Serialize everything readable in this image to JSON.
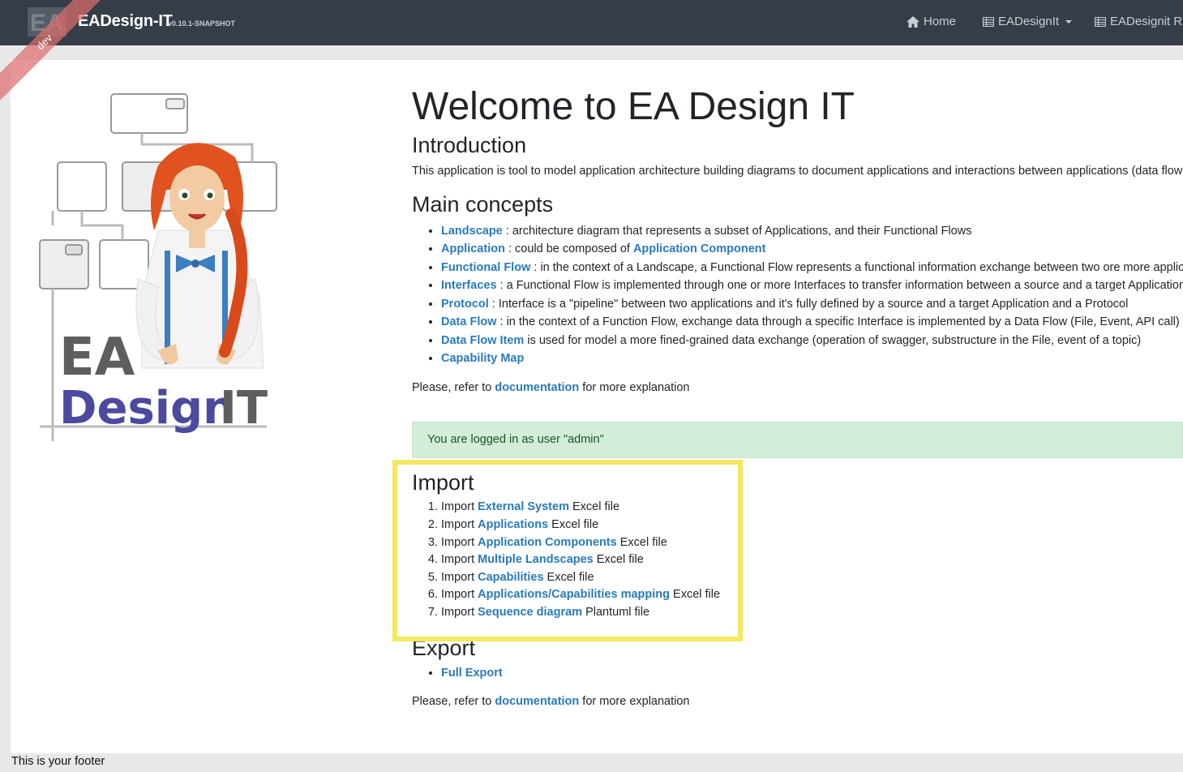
{
  "navbar": {
    "brand_title": "EADesign-IT",
    "brand_version": "v0.10.1-SNAPSHOT",
    "ribbon_label": "dev",
    "home_label": "Home",
    "eadesignit_label": "EADesignIt",
    "eadesignit_r_label": "EADesignit Re"
  },
  "illustration": {
    "line1": "EA",
    "line2a": "Design",
    "line2b": "IT"
  },
  "main": {
    "title": "Welcome to EA Design IT",
    "intro_heading": "Introduction",
    "intro_text": "This application is tool to model application architecture building diagrams to document applications and interactions between applications (data flows)",
    "concepts_heading": "Main concepts",
    "concepts": [
      {
        "link": "Landscape",
        "text": " : architecture diagram that represents a subset of Applications, and their Functional Flows"
      },
      {
        "link": "Application",
        "text": " : could be composed of ",
        "link2": "Application Component"
      },
      {
        "link": "Functional Flow",
        "text": " : in the context of a Landscape, a Functional Flow represents a functional information exchange between two ore more applica"
      },
      {
        "link": "Interfaces",
        "text": " : a Functional Flow is implemented through one or more Interfaces to transfer information between a source and a target Application."
      },
      {
        "link": "Protocol",
        "text": " : Interface is a \"pipeline\" between two applications and it's fully defined by a source and a target Application and a Protocol"
      },
      {
        "link": "Data Flow",
        "text": " : in the context of a Function Flow, exchange data through a specific Interface is implemented by a Data Flow (File, Event, API call)"
      },
      {
        "link": "Data Flow Item",
        "text": " is used for model a more fined-grained data exchange (operation of swagger, substructure in the File, event of a topic)"
      },
      {
        "link": "Capability Map",
        "text": ""
      }
    ],
    "refer_prefix": "Please, refer to ",
    "refer_link": "documentation",
    "refer_suffix": " for more explanation",
    "alert_text": "You are logged in as user \"admin\"",
    "import_heading": "Import",
    "imports": [
      {
        "prefix": "Import ",
        "link": "External System",
        "suffix": " Excel file"
      },
      {
        "prefix": "Import ",
        "link": "Applications",
        "suffix": " Excel file"
      },
      {
        "prefix": "Import ",
        "link": "Application Components",
        "suffix": " Excel file"
      },
      {
        "prefix": "Import ",
        "link": "Multiple Landscapes",
        "suffix": " Excel file"
      },
      {
        "prefix": "Import ",
        "link": "Capabilities",
        "suffix": " Excel file"
      },
      {
        "prefix": "Import ",
        "link": "Applications/Capabilities mapping",
        "suffix": " Excel file"
      },
      {
        "prefix": "Import ",
        "link": "Sequence diagram",
        "suffix": " Plantuml file"
      }
    ],
    "export_heading": "Export",
    "export_link": "Full Export",
    "refer2_prefix": "Please, refer to ",
    "refer2_link": "documentation",
    "refer2_suffix": " for more explanation"
  },
  "footer": {
    "text": "This is your footer"
  },
  "colors": {
    "navbar_bg": "#353d47",
    "link": "#2a7ab8",
    "alert_bg": "#d4edda",
    "highlight": "#f3e860",
    "design_text": "#4b4a9e"
  }
}
